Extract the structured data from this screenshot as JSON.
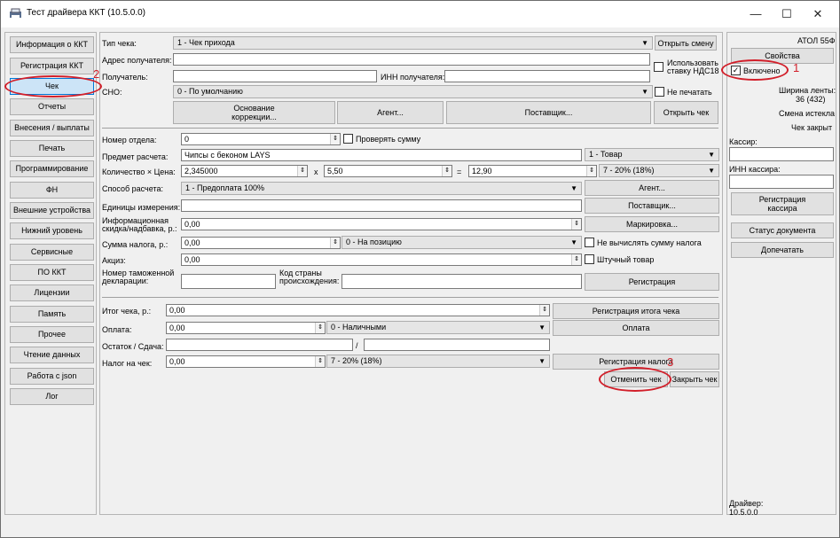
{
  "window": {
    "title": "Тест драйвера ККТ (10.5.0.0)",
    "minimize": "—",
    "maximize": "☐",
    "close": "✕"
  },
  "nav": [
    "Информация о ККТ",
    "Регистрация ККТ",
    "Чек",
    "Отчеты",
    "Внесения / выплаты",
    "Печать",
    "Программирование",
    "ФН",
    "Внешние устройства",
    "Нижний уровень",
    "Сервисные",
    "ПО ККТ",
    "Лицензии",
    "Память",
    "Прочее",
    "Чтение данных",
    "Работа с json",
    "Лог"
  ],
  "form": {
    "check_type_label": "Тип чека:",
    "check_type_value": "1 - Чек прихода",
    "open_shift": "Открыть смену",
    "recipient_address_label": "Адрес получателя:",
    "recipient_label": "Получатель:",
    "recipient_inn_label": "ИНН получателя:",
    "use_vat18": "Использовать ставку НДС18",
    "sno_label": "СНО:",
    "sno_value": "0 - По умолчанию",
    "no_print": "Не печатать",
    "correction_basis": "Основание коррекции...",
    "agent": "Агент...",
    "supplier": "Поставщик...",
    "open_check": "Открыть чек",
    "dept_label": "Номер отдела:",
    "dept_value": "0",
    "check_sum": "Проверять сумму",
    "item_label": "Предмет расчета:",
    "item_value": "Чипсы с беконом LAYS",
    "item_type": "1 - Товар",
    "qty_label": "Количество × Цена:",
    "qty_value": "2,345000",
    "times": "x",
    "price_value": "5,50",
    "equals": "=",
    "total_value": "12,90",
    "vat_value": "7 - 20% (18%)",
    "pay_method_label": "Способ расчета:",
    "pay_method_value": "1 - Предоплата 100%",
    "agent2": "Агент...",
    "unit_label": "Единицы измерения:",
    "supplier2": "Поставщик...",
    "info_discount_label": "Информационная скидка/надбавка, р.:",
    "info_discount_value": "0,00",
    "marking": "Маркировка...",
    "tax_sum_label": "Сумма налога, р.:",
    "tax_sum_value": "0,00",
    "tax_mode": "0 - На позицию",
    "no_calc_tax": "Не вычислять сумму налога",
    "excise_label": "Акциз:",
    "excise_value": "0,00",
    "piece_goods": "Штучный товар",
    "customs_label": "Номер таможенной декларации:",
    "country_label": "Код страны происхождения:",
    "register": "Регистрация",
    "check_total_label": "Итог чека, р.:",
    "check_total_value": "0,00",
    "register_total": "Регистрация итога чека",
    "payment_label": "Оплата:",
    "payment_value": "0,00",
    "payment_type": "0 - Наличными",
    "payment_btn": "Оплата",
    "change_label": "Остаток / Сдача:",
    "slash": "/",
    "tax_check_label": "Налог на чек:",
    "tax_check_value": "0,00",
    "tax_check_vat": "7 - 20% (18%)",
    "register_tax": "Регистрация налога",
    "cancel_check": "Отменить чек",
    "close_check": "Закрыть чек"
  },
  "right": {
    "device": "АТОЛ 55Ф",
    "properties": "Свойства",
    "enabled": "Включено",
    "tape_width_label": "Ширина ленты:",
    "tape_width_value": "36 (432)",
    "shift_status": "Смена истекла",
    "check_status": "Чек закрыт",
    "cashier_label": "Кассир:",
    "cashier_inn_label": "ИНН кассира:",
    "register_cashier": "Регистрация кассира",
    "doc_status": "Статус документа",
    "reprint": "Допечатать",
    "driver_label": "Драйвер:",
    "driver_version": "10.5.0.0"
  },
  "annotations": [
    "1",
    "2",
    "3"
  ],
  "checkmark": "✓",
  "arrow_down": "▼",
  "spin_glyph": "⇕",
  "colors": {
    "annotation": "#d21f2a",
    "selected_nav": "#cce4f7"
  }
}
